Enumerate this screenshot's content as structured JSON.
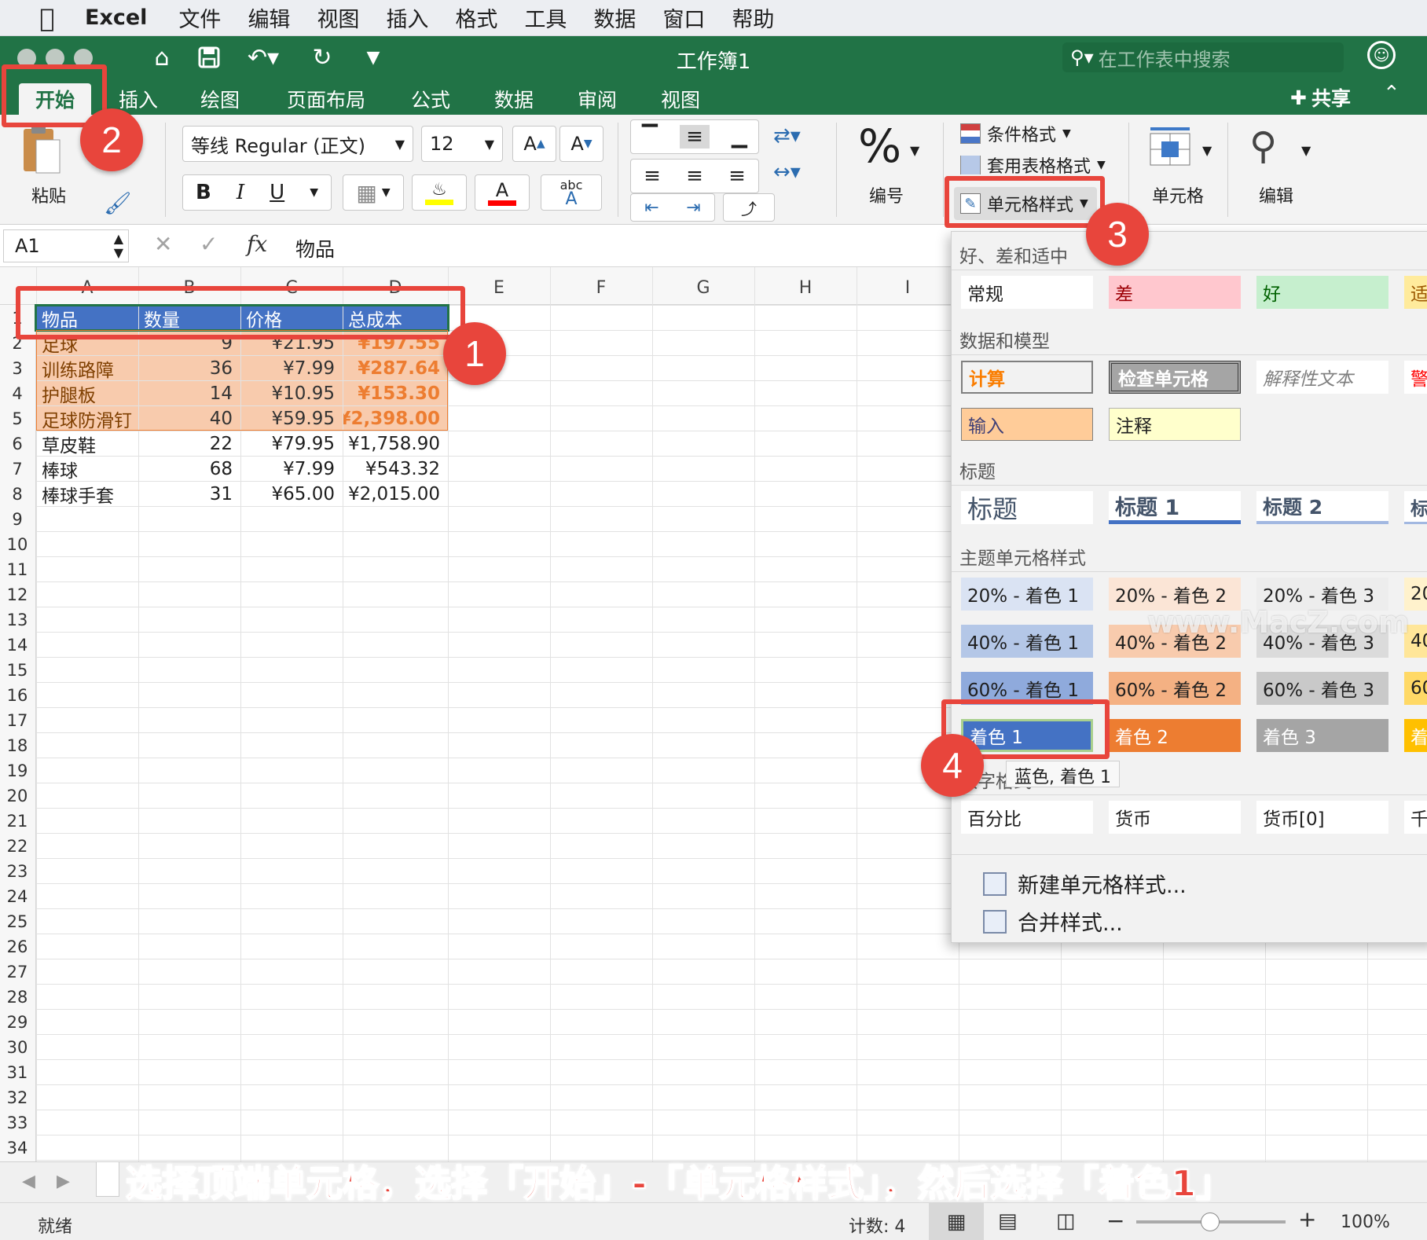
{
  "menubar": {
    "apple_icon": "apple-icon",
    "items": [
      "Excel",
      "文件",
      "编辑",
      "视图",
      "插入",
      "格式",
      "工具",
      "数据",
      "窗口",
      "帮助"
    ]
  },
  "titlebar": {
    "title": "工作簿1",
    "search_placeholder": "在工作表中搜索"
  },
  "tabs": [
    "开始",
    "插入",
    "绘图",
    "页面布局",
    "公式",
    "数据",
    "审阅",
    "视图"
  ],
  "share_label": "共享",
  "ribbon": {
    "paste_label": "粘贴",
    "font_name": "等线 Regular (正文)",
    "font_size": "12",
    "bold": "B",
    "italic": "I",
    "underline": "U",
    "grow_font": "A",
    "shrink_font": "A",
    "phonetic": "abc",
    "number_label": "编号",
    "number_icon": "%",
    "cond_format": "条件格式",
    "table_format": "套用表格格式",
    "cell_styles": "单元格样式",
    "cells_label": "单元格",
    "edit_label": "编辑"
  },
  "formula_bar": {
    "name_box": "A1",
    "fx": "fx",
    "value": "物品"
  },
  "columns": [
    "A",
    "B",
    "C",
    "D",
    "E",
    "F",
    "G",
    "H",
    "I"
  ],
  "rows": [
    "1",
    "2",
    "3",
    "4",
    "5",
    "6",
    "7",
    "8",
    "9",
    "10",
    "11",
    "12",
    "13",
    "14",
    "15",
    "16",
    "17",
    "18",
    "19",
    "20",
    "21",
    "22",
    "23",
    "24",
    "25",
    "26",
    "27",
    "28",
    "29",
    "30",
    "31",
    "32",
    "33",
    "34"
  ],
  "table": {
    "headers": [
      "物品",
      "数量",
      "价格",
      "总成本"
    ],
    "data": [
      [
        "足球",
        "9",
        "¥21.95",
        "¥197.55"
      ],
      [
        "训练路障",
        "36",
        "¥7.99",
        "¥287.64"
      ],
      [
        "护腿板",
        "14",
        "¥10.95",
        "¥153.30"
      ],
      [
        "足球防滑钉",
        "40",
        "¥59.95",
        "¥2,398.00"
      ],
      [
        "草皮鞋",
        "22",
        "¥79.95",
        "¥1,758.90"
      ],
      [
        "棒球",
        "68",
        "¥7.99",
        "¥543.32"
      ],
      [
        "棒球手套",
        "31",
        "¥65.00",
        "¥2,015.00"
      ]
    ]
  },
  "dropdown": {
    "sections": [
      "好、差和适中",
      "数据和模型",
      "标题",
      "主题单元格样式",
      "数字格式"
    ],
    "good_bad": [
      "常规",
      "差",
      "好",
      "适"
    ],
    "data_model_1": [
      "计算",
      "检查单元格",
      "解释性文本",
      "警"
    ],
    "data_model_2": [
      "输入",
      "注释"
    ],
    "titles": [
      "标题",
      "标题 1",
      "标题 2",
      "标"
    ],
    "theme_20": [
      "20% - 着色 1",
      "20% - 着色 2",
      "20% - 着色 3",
      "20"
    ],
    "theme_40": [
      "40% - 着色 1",
      "40% - 着色 2",
      "40% - 着色 3",
      "40"
    ],
    "theme_60": [
      "60% - 着色 1",
      "60% - 着色 2",
      "60% - 着色 3",
      "60"
    ],
    "theme_accent": [
      "着色 1",
      "着色 2",
      "着色 3",
      "着"
    ],
    "number_fmt": [
      "百分比",
      "货币",
      "货币[0]",
      "千"
    ],
    "new_style": "新建单元格样式...",
    "merge_style": "合并样式...",
    "tooltip": "蓝色, 着色 1"
  },
  "annotations": {
    "badges": [
      "1",
      "2",
      "3",
      "4"
    ],
    "caption": "选择顶端单元格，选择「开始」-「单元格样式」，然后选择「着色1」",
    "watermark": "www.MacZ.com"
  },
  "sheet_tabs": [],
  "status": {
    "ready": "就绪",
    "count": "计数: 4",
    "zoom": "100%"
  },
  "colors": {
    "excel_green": "#217346",
    "accent1": "#4472c4",
    "accent2": "#ed7d31",
    "accent3": "#a5a5a5",
    "annotation_red": "#e8453c",
    "orange_fill": "#f8cbad"
  }
}
